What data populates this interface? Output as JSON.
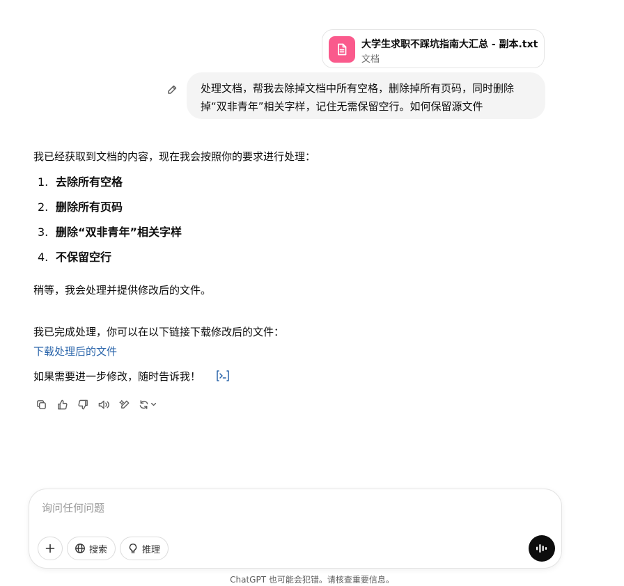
{
  "attachment": {
    "file_name": "大学生求职不踩坑指南大汇总 - 副本.txt",
    "file_type": "文档",
    "icon": "document-icon",
    "color": "#fa5a8c"
  },
  "user_message": {
    "text": "处理文档，帮我去除掉文档中所有空格，删除掉所有页码，同时删除掉“双非青年”相关字样，记住无需保留空行。如何保留源文件"
  },
  "assistant_message": {
    "intro": "我已经获取到文档的内容，现在我会按照你的要求进行处理：",
    "steps": [
      {
        "num": "1.",
        "text": "去除所有空格"
      },
      {
        "num": "2.",
        "text": "删除所有页码"
      },
      {
        "num": "3.",
        "text": "删除“双非青年”相关字样"
      },
      {
        "num": "4.",
        "text": "不保留空行"
      }
    ],
    "waiting": "稍等，我会处理并提供修改后的文件。",
    "done": "我已完成处理，你可以在以下链接下载修改后的文件：",
    "download_link": "下载处理后的文件",
    "closing": "如果需要进一步修改，随时告诉我！",
    "link_color": "#2964aa"
  },
  "message_actions": [
    "copy-icon",
    "thumbs-up-icon",
    "thumbs-down-icon",
    "read-aloud-icon",
    "edit-canvas-icon",
    "regenerate-icon"
  ],
  "composer": {
    "placeholder": "询问任何问题",
    "search_label": "搜索",
    "reason_label": "推理"
  },
  "disclaimer": "ChatGPT 也可能会犯错。请核查重要信息。"
}
